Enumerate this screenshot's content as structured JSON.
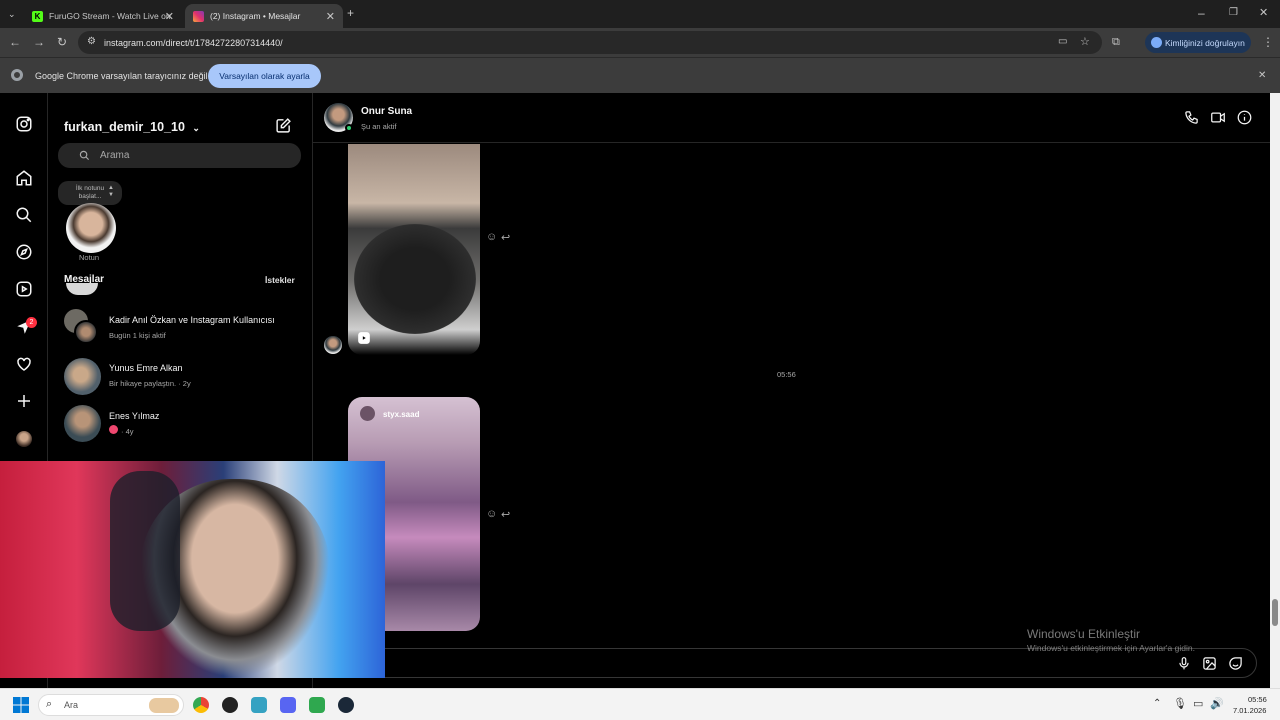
{
  "browser": {
    "tabs": [
      {
        "title": "FuruGO Stream - Watch Live on",
        "favicon_color": "#53fc18"
      },
      {
        "title": "(2) Instagram • Mesajlar",
        "favicon_color": "#e1306c"
      }
    ],
    "url": "instagram.com/direct/t/17842722807314440/",
    "identity_label": "Kimliğinizi doğrulayın",
    "infobar": {
      "text": "Google Chrome varsayılan tarayıcınız değil",
      "button": "Varsayılan olarak ayarla"
    }
  },
  "sidebar": {
    "notification_count": "2"
  },
  "inbox": {
    "username": "furkan_demir_10_10",
    "search_placeholder": "Arama",
    "note": {
      "bubble_line1": "İlk notunu",
      "bubble_line2": "başlat...",
      "label": "Notun"
    },
    "section_title": "Mesajlar",
    "requests_label": "İstekler",
    "conversations": [
      {
        "name": "Kadir Anıl Özkan ve Instagram Kullanıcısı",
        "subtitle": "Bugün 1 kişi aktif"
      },
      {
        "name": "Yunus Emre Alkan",
        "subtitle": "Bir hikaye paylaştın. · 2y"
      },
      {
        "name": "Enes Yılmaz",
        "subtitle": "· 4y"
      }
    ]
  },
  "chat": {
    "contact_name": "Onur Suna",
    "contact_status": "Şu an aktif",
    "timestamp": "05:56",
    "shared_post_user": "styx.saad"
  },
  "watermark": {
    "title": "Windows'u Etkinleştir",
    "subtitle": "Windows'u etkinleştirmek için Ayarlar'a gidin."
  },
  "taskbar": {
    "search_placeholder": "Ara",
    "time": "05:56",
    "date": "7.01.2026"
  }
}
